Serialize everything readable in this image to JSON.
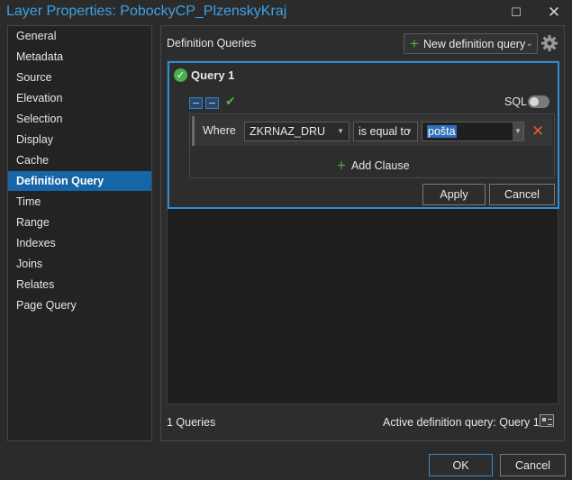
{
  "window": {
    "title": "Layer Properties: PobockyCP_PlzenskyKraj",
    "minimize_glyph": "☐",
    "close_glyph": "✕"
  },
  "sidebar": {
    "items": [
      {
        "label": "General"
      },
      {
        "label": "Metadata"
      },
      {
        "label": "Source"
      },
      {
        "label": "Elevation"
      },
      {
        "label": "Selection"
      },
      {
        "label": "Display"
      },
      {
        "label": "Cache"
      },
      {
        "label": "Definition Query",
        "selected": true
      },
      {
        "label": "Time"
      },
      {
        "label": "Range"
      },
      {
        "label": "Indexes"
      },
      {
        "label": "Joins"
      },
      {
        "label": "Relates"
      },
      {
        "label": "Page Query"
      }
    ]
  },
  "main": {
    "heading": "Definition Queries",
    "new_query_button": "New definition query",
    "query": {
      "title": "Query 1",
      "sql_label": "SQL",
      "sql_toggle_on": false,
      "clause": {
        "where_label": "Where",
        "field": "ZKRNAZ_DRU",
        "operator": "is equal to",
        "value": "pošta"
      },
      "add_clause_label": "Add Clause",
      "apply_button": "Apply",
      "cancel_button": "Cancel"
    },
    "footer": {
      "count": "1 Queries",
      "active": "Active definition query: Query 1"
    }
  },
  "dialog_buttons": {
    "ok": "OK",
    "cancel": "Cancel"
  },
  "colors": {
    "accent": "#2f8dda",
    "title": "#3fa0e6",
    "selected_nav": "#1565a7",
    "success": "#52b043",
    "remove": "#e05a35"
  },
  "icons": [
    "minimize-icon",
    "close-icon",
    "gear-icon",
    "check-icon",
    "plus-icon",
    "remove-icon",
    "validate-icon",
    "active-query-icon"
  ]
}
